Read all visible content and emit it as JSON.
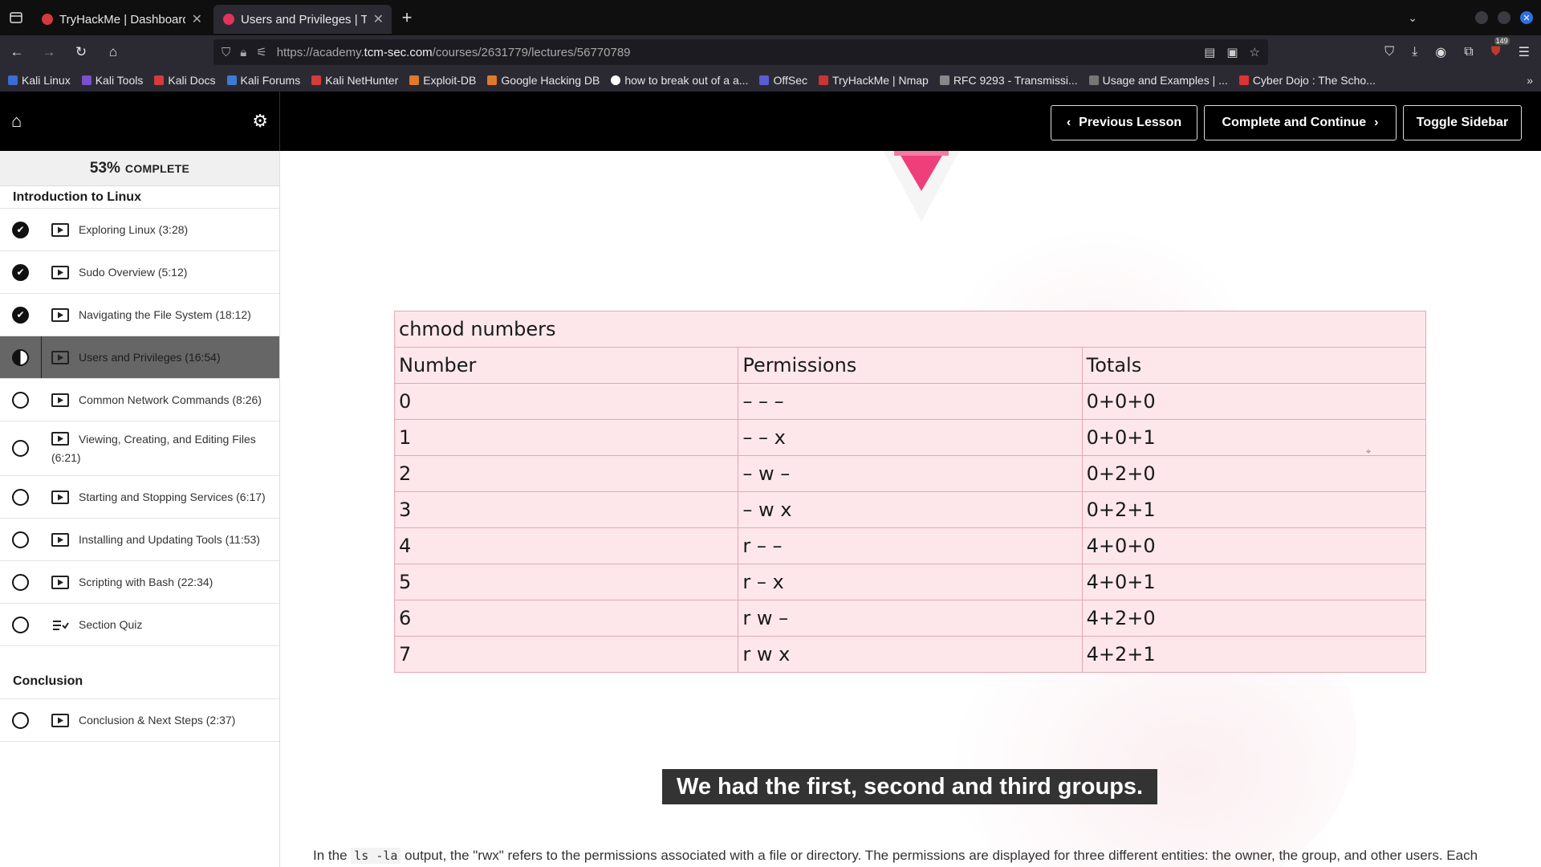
{
  "browser": {
    "tabs": [
      {
        "title": "TryHackMe | Dashboard",
        "active": false,
        "favicon_color": "#d33a3a"
      },
      {
        "title": "Users and Privileges | TCM",
        "active": true,
        "favicon_color": "#e2335a"
      }
    ],
    "url_prefix": "https://academy.",
    "url_domain": "tcm-sec.com",
    "url_path": "/courses/2631779/lectures/56770789",
    "extension_badge": "149",
    "bookmarks": [
      "Kali Linux",
      "Kali Tools",
      "Kali Docs",
      "Kali Forums",
      "Kali NetHunter",
      "Exploit-DB",
      "Google Hacking DB",
      "how to break out of a a...",
      "OffSec",
      "TryHackMe | Nmap",
      "RFC 9293 - Transmissi...",
      "Usage and Examples | ...",
      "Cyber Dojo : The Scho..."
    ]
  },
  "header": {
    "prev_label": "Previous Lesson",
    "complete_label": "Complete and Continue",
    "toggle_label": "Toggle Sidebar"
  },
  "sidebar": {
    "progress_pct": "53%",
    "progress_label": "COMPLETE",
    "sections": [
      {
        "title": "Introduction to Linux",
        "items": [
          {
            "label": "Exploring Linux (3:28)",
            "status": "done",
            "type": "video"
          },
          {
            "label": "Sudo Overview (5:12)",
            "status": "done",
            "type": "video"
          },
          {
            "label": "Navigating the File System (18:12)",
            "status": "done",
            "type": "video"
          },
          {
            "label": "Users and Privileges (16:54)",
            "status": "current",
            "type": "video"
          },
          {
            "label": "Common Network Commands (8:26)",
            "status": "todo",
            "type": "video"
          },
          {
            "label": "Viewing, Creating, and Editing Files (6:21)",
            "status": "todo",
            "type": "video"
          },
          {
            "label": "Starting and Stopping Services (6:17)",
            "status": "todo",
            "type": "video"
          },
          {
            "label": "Installing and Updating Tools (11:53)",
            "status": "todo",
            "type": "video"
          },
          {
            "label": "Scripting with Bash (22:34)",
            "status": "todo",
            "type": "video"
          },
          {
            "label": "Section Quiz",
            "status": "todo",
            "type": "quiz"
          }
        ]
      },
      {
        "title": "Conclusion",
        "items": [
          {
            "label": "Conclusion & Next Steps (2:37)",
            "status": "todo",
            "type": "video"
          }
        ]
      }
    ]
  },
  "main": {
    "table": {
      "caption": "chmod numbers",
      "headers": [
        "Number",
        "Permissions",
        "Totals"
      ],
      "rows": [
        [
          "0",
          "– – –",
          "0+0+0"
        ],
        [
          "1",
          "– – x",
          "0+0+1"
        ],
        [
          "2",
          "– w –",
          "0+2+0"
        ],
        [
          "3",
          "– w x",
          "0+2+1"
        ],
        [
          "4",
          "r – –",
          "4+0+0"
        ],
        [
          "5",
          "r – x",
          "4+0+1"
        ],
        [
          "6",
          "r w –",
          "4+2+0"
        ],
        [
          "7",
          "r w x",
          "4+2+1"
        ]
      ]
    },
    "video_caption": "We had the first, second and third groups.",
    "paragraph": {
      "before": "In the ",
      "code": "ls -la",
      "after": " output, the \"rwx\" refers to the permissions associated with a file or directory. The permissions are displayed for three different entities: the owner, the group, and other users. Each"
    }
  },
  "colors": {
    "table_bg": "#fde7eb",
    "table_border": "#e6a6b2",
    "triangle": "#ee3f7a",
    "active_item_bg": "#666666"
  }
}
